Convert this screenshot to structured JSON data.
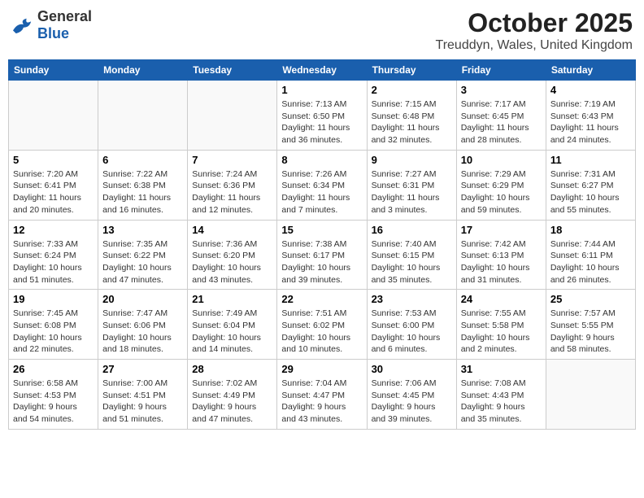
{
  "logo": {
    "general": "General",
    "blue": "Blue"
  },
  "title": "October 2025",
  "location": "Treuddyn, Wales, United Kingdom",
  "days": [
    "Sunday",
    "Monday",
    "Tuesday",
    "Wednesday",
    "Thursday",
    "Friday",
    "Saturday"
  ],
  "weeks": [
    [
      {
        "day": "",
        "info": ""
      },
      {
        "day": "",
        "info": ""
      },
      {
        "day": "",
        "info": ""
      },
      {
        "day": "1",
        "info": "Sunrise: 7:13 AM\nSunset: 6:50 PM\nDaylight: 11 hours\nand 36 minutes."
      },
      {
        "day": "2",
        "info": "Sunrise: 7:15 AM\nSunset: 6:48 PM\nDaylight: 11 hours\nand 32 minutes."
      },
      {
        "day": "3",
        "info": "Sunrise: 7:17 AM\nSunset: 6:45 PM\nDaylight: 11 hours\nand 28 minutes."
      },
      {
        "day": "4",
        "info": "Sunrise: 7:19 AM\nSunset: 6:43 PM\nDaylight: 11 hours\nand 24 minutes."
      }
    ],
    [
      {
        "day": "5",
        "info": "Sunrise: 7:20 AM\nSunset: 6:41 PM\nDaylight: 11 hours\nand 20 minutes."
      },
      {
        "day": "6",
        "info": "Sunrise: 7:22 AM\nSunset: 6:38 PM\nDaylight: 11 hours\nand 16 minutes."
      },
      {
        "day": "7",
        "info": "Sunrise: 7:24 AM\nSunset: 6:36 PM\nDaylight: 11 hours\nand 12 minutes."
      },
      {
        "day": "8",
        "info": "Sunrise: 7:26 AM\nSunset: 6:34 PM\nDaylight: 11 hours\nand 7 minutes."
      },
      {
        "day": "9",
        "info": "Sunrise: 7:27 AM\nSunset: 6:31 PM\nDaylight: 11 hours\nand 3 minutes."
      },
      {
        "day": "10",
        "info": "Sunrise: 7:29 AM\nSunset: 6:29 PM\nDaylight: 10 hours\nand 59 minutes."
      },
      {
        "day": "11",
        "info": "Sunrise: 7:31 AM\nSunset: 6:27 PM\nDaylight: 10 hours\nand 55 minutes."
      }
    ],
    [
      {
        "day": "12",
        "info": "Sunrise: 7:33 AM\nSunset: 6:24 PM\nDaylight: 10 hours\nand 51 minutes."
      },
      {
        "day": "13",
        "info": "Sunrise: 7:35 AM\nSunset: 6:22 PM\nDaylight: 10 hours\nand 47 minutes."
      },
      {
        "day": "14",
        "info": "Sunrise: 7:36 AM\nSunset: 6:20 PM\nDaylight: 10 hours\nand 43 minutes."
      },
      {
        "day": "15",
        "info": "Sunrise: 7:38 AM\nSunset: 6:17 PM\nDaylight: 10 hours\nand 39 minutes."
      },
      {
        "day": "16",
        "info": "Sunrise: 7:40 AM\nSunset: 6:15 PM\nDaylight: 10 hours\nand 35 minutes."
      },
      {
        "day": "17",
        "info": "Sunrise: 7:42 AM\nSunset: 6:13 PM\nDaylight: 10 hours\nand 31 minutes."
      },
      {
        "day": "18",
        "info": "Sunrise: 7:44 AM\nSunset: 6:11 PM\nDaylight: 10 hours\nand 26 minutes."
      }
    ],
    [
      {
        "day": "19",
        "info": "Sunrise: 7:45 AM\nSunset: 6:08 PM\nDaylight: 10 hours\nand 22 minutes."
      },
      {
        "day": "20",
        "info": "Sunrise: 7:47 AM\nSunset: 6:06 PM\nDaylight: 10 hours\nand 18 minutes."
      },
      {
        "day": "21",
        "info": "Sunrise: 7:49 AM\nSunset: 6:04 PM\nDaylight: 10 hours\nand 14 minutes."
      },
      {
        "day": "22",
        "info": "Sunrise: 7:51 AM\nSunset: 6:02 PM\nDaylight: 10 hours\nand 10 minutes."
      },
      {
        "day": "23",
        "info": "Sunrise: 7:53 AM\nSunset: 6:00 PM\nDaylight: 10 hours\nand 6 minutes."
      },
      {
        "day": "24",
        "info": "Sunrise: 7:55 AM\nSunset: 5:58 PM\nDaylight: 10 hours\nand 2 minutes."
      },
      {
        "day": "25",
        "info": "Sunrise: 7:57 AM\nSunset: 5:55 PM\nDaylight: 9 hours\nand 58 minutes."
      }
    ],
    [
      {
        "day": "26",
        "info": "Sunrise: 6:58 AM\nSunset: 4:53 PM\nDaylight: 9 hours\nand 54 minutes."
      },
      {
        "day": "27",
        "info": "Sunrise: 7:00 AM\nSunset: 4:51 PM\nDaylight: 9 hours\nand 51 minutes."
      },
      {
        "day": "28",
        "info": "Sunrise: 7:02 AM\nSunset: 4:49 PM\nDaylight: 9 hours\nand 47 minutes."
      },
      {
        "day": "29",
        "info": "Sunrise: 7:04 AM\nSunset: 4:47 PM\nDaylight: 9 hours\nand 43 minutes."
      },
      {
        "day": "30",
        "info": "Sunrise: 7:06 AM\nSunset: 4:45 PM\nDaylight: 9 hours\nand 39 minutes."
      },
      {
        "day": "31",
        "info": "Sunrise: 7:08 AM\nSunset: 4:43 PM\nDaylight: 9 hours\nand 35 minutes."
      },
      {
        "day": "",
        "info": ""
      }
    ]
  ]
}
